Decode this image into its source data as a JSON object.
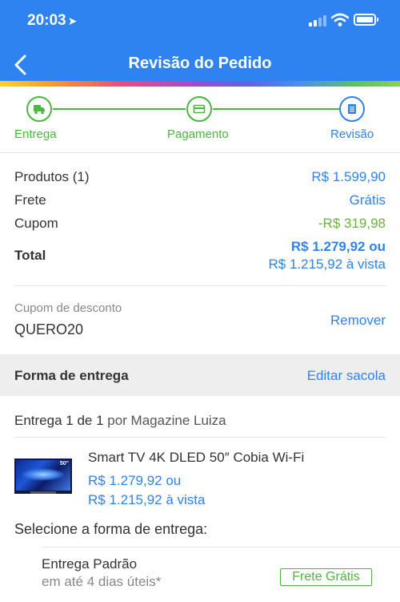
{
  "status_bar": {
    "time": "20:03",
    "location_icon": "location-arrow-icon"
  },
  "header": {
    "title": "Revisão do Pedido",
    "back_icon": "chevron-left-icon"
  },
  "stepper": {
    "steps": [
      {
        "label": "Entrega",
        "icon": "truck-icon",
        "state": "done"
      },
      {
        "label": "Pagamento",
        "icon": "credit-card-icon",
        "state": "done"
      },
      {
        "label": "Revisão",
        "icon": "list-icon",
        "state": "current"
      }
    ],
    "done_color": "#48b83e",
    "current_color": "#2f83f0"
  },
  "summary": {
    "products_label": "Produtos (1)",
    "products_value": "R$ 1.599,90",
    "shipping_label": "Frete",
    "shipping_value": "Grátis",
    "coupon_label": "Cupom",
    "coupon_value": "-R$ 319,98",
    "total_label": "Total",
    "total_line1": "R$ 1.279,92 ou",
    "total_line2": "R$ 1.215,92 à vista"
  },
  "coupon": {
    "label": "Cupom de desconto",
    "code": "QUERO20",
    "remove_label": "Remover"
  },
  "delivery_section": {
    "title": "Forma de entrega",
    "edit_label": "Editar sacola",
    "delivery_count": "Entrega 1 de 1",
    "seller": "por Magazine Luiza"
  },
  "product": {
    "name": "Smart TV 4K DLED 50″ Cobia Wi-Fi",
    "price_line1": "R$ 1.279,92 ou",
    "price_line2": "R$ 1.215,92 à vista",
    "thumb_badge": "50\""
  },
  "shipping_options": {
    "title": "Selecione a forma de entrega:",
    "option_name": "Entrega Padrão",
    "option_eta": "em até 4 dias úteis*",
    "option_badge": "Frete Grátis"
  },
  "colors": {
    "brand_blue": "#2f83f0",
    "success_green": "#48b83e",
    "discount_green": "#6ab23e"
  }
}
